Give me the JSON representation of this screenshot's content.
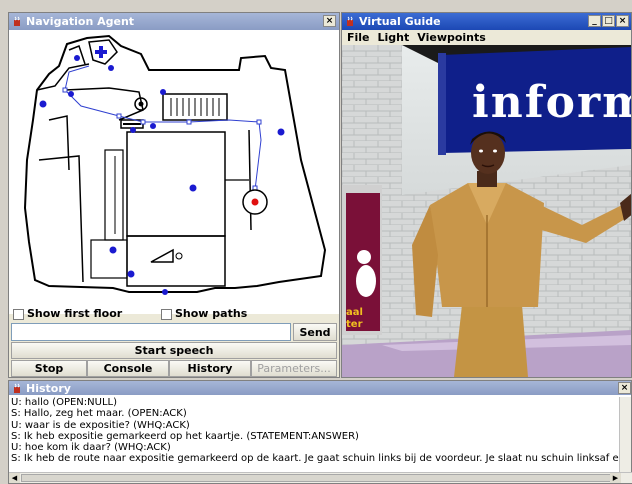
{
  "nav_window": {
    "title": "Navigation Agent",
    "close_label": "×",
    "show_first_floor": "Show first floor",
    "show_paths": "Show paths",
    "send": "Send",
    "start_speech": "Start speech",
    "buttons": [
      "Stop",
      "Console",
      "History",
      "Parameters..."
    ]
  },
  "guide_window": {
    "title": "Virtual Guide",
    "menu": [
      "File",
      "Light",
      "Viewpoints"
    ],
    "controls": [
      "_",
      "□",
      "×"
    ],
    "sign_text": "inform",
    "poster_text": [
      "aal",
      "ter"
    ]
  },
  "history_window": {
    "title": "History",
    "close_label": "×",
    "lines": [
      "U: hallo (OPEN:NULL)",
      "S: Hallo, zeg het maar. (OPEN:ACK)",
      "U: waar is de expositie? (WHQ:ACK)",
      "S: Ik heb expositie gemarkeerd op het kaartje. (STATEMENT:ANSWER)",
      "U: hoe kom ik daar? (WHQ:ACK)",
      "S: Ik heb de route naar expositie gemarkeerd op de kaart. Je gaat schuin links bij de voordeur. Je slaat nu schuin linksaf en hierna sla je de tweede rechtsaf."
    ]
  },
  "colors": {
    "title_active": "#2a58c4",
    "title_inactive": "#9aaad0",
    "map_marker": "#1a1ad0",
    "target_marker": "#e01010",
    "sign_blue": "#0f1f8a"
  }
}
